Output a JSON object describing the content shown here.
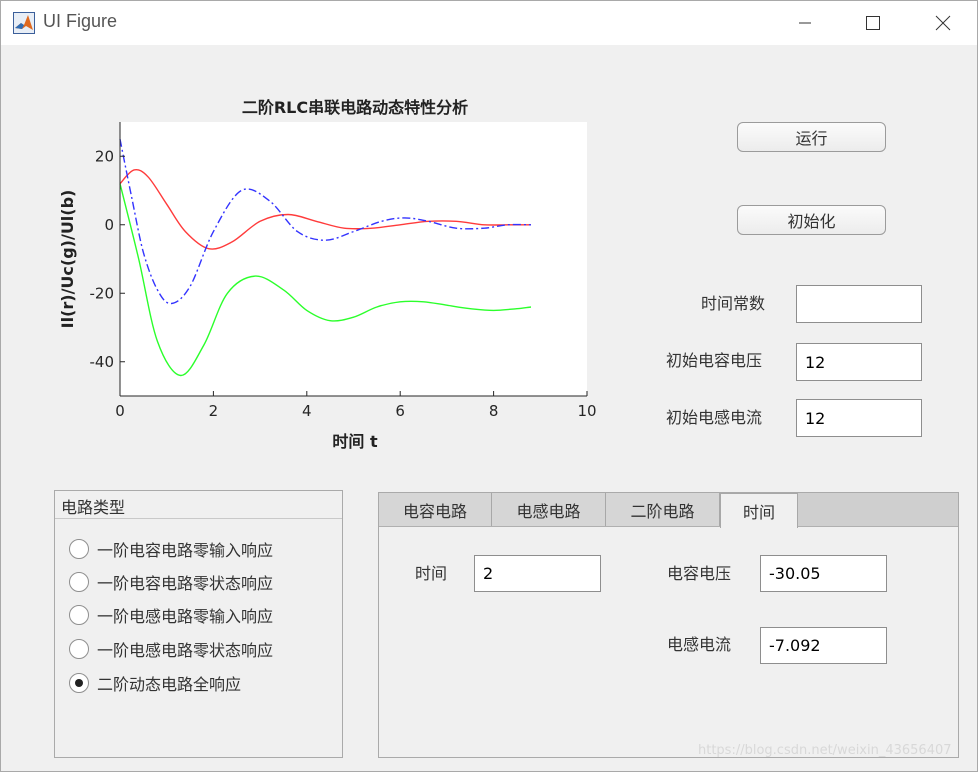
{
  "window": {
    "title": "UI Figure",
    "controls": [
      "minimize",
      "maximize",
      "close"
    ]
  },
  "buttons": {
    "run": "运行",
    "init": "初始化"
  },
  "params": {
    "time_constant": {
      "label": "时间常数",
      "value": ""
    },
    "init_cap_voltage": {
      "label": "初始电容电压",
      "value": "12"
    },
    "init_ind_current": {
      "label": "初始电感电流",
      "value": "12"
    }
  },
  "circuit_group": {
    "title": "电路类型",
    "options": [
      {
        "label": "一阶电容电路零输入响应",
        "selected": false
      },
      {
        "label": "一阶电容电路零状态响应",
        "selected": false
      },
      {
        "label": "一阶电感电路零输入响应",
        "selected": false
      },
      {
        "label": "一阶电感电路零状态响应",
        "selected": false
      },
      {
        "label": "二阶动态电路全响应",
        "selected": true
      }
    ]
  },
  "tabs": {
    "items": [
      "电容电路",
      "电感电路",
      "二阶电路",
      "时间"
    ],
    "active": 3
  },
  "time_tab": {
    "time_label": "时间",
    "time_value": "2",
    "cap_voltage_label": "电容电压",
    "cap_voltage_value": "-30.05",
    "ind_current_label": "电感电流",
    "ind_current_value": "-7.092"
  },
  "watermark": "https://blog.csdn.net/weixin_43656407",
  "chart_data": {
    "type": "line",
    "title": "二阶RLC串联电路动态特性分析",
    "xlabel": "时间 t",
    "ylabel": "Il(r)/Uc(g)/Ul(b)",
    "xlim": [
      0,
      10
    ],
    "ylim": [
      -50,
      30
    ],
    "xticks": [
      0,
      2,
      4,
      6,
      8,
      10
    ],
    "yticks": [
      20,
      0,
      -20,
      -40
    ],
    "grid": false,
    "series": [
      {
        "color": "#ff3b3b",
        "style": "solid",
        "x": [
          0,
          0.3,
          0.6,
          1.0,
          1.4,
          1.9,
          2.4,
          3.0,
          3.6,
          4.2,
          4.8,
          5.4,
          6.0,
          6.6,
          7.2,
          7.8,
          8.3,
          8.8
        ],
        "y": [
          12,
          16,
          14,
          6,
          -2,
          -7,
          -5,
          1,
          3,
          1,
          -1,
          -1,
          0,
          1,
          1,
          0,
          0,
          0
        ]
      },
      {
        "color": "#2bff2b",
        "style": "solid",
        "x": [
          0,
          0.4,
          0.8,
          1.3,
          1.8,
          2.3,
          2.9,
          3.5,
          4.0,
          4.5,
          5.0,
          5.5,
          6.0,
          6.5,
          7.0,
          7.5,
          8.0,
          8.5,
          8.8
        ],
        "y": [
          12,
          -10,
          -34,
          -44,
          -35,
          -20,
          -15,
          -19,
          -25,
          -28,
          -27,
          -24,
          -22.5,
          -22.5,
          -23.5,
          -24.5,
          -25,
          -24.5,
          -24
        ]
      },
      {
        "color": "#3333ff",
        "style": "dashdot",
        "x": [
          0,
          0.25,
          0.5,
          0.8,
          1.1,
          1.5,
          2.0,
          2.6,
          3.2,
          3.8,
          4.4,
          5.0,
          5.6,
          6.1,
          6.6,
          7.2,
          7.8,
          8.3,
          8.8
        ],
        "y": [
          25,
          8,
          -8,
          -19,
          -23,
          -18,
          -2,
          10,
          7,
          -2,
          -4.5,
          -2,
          1,
          2,
          1,
          -1,
          -1,
          0,
          0
        ]
      }
    ]
  }
}
